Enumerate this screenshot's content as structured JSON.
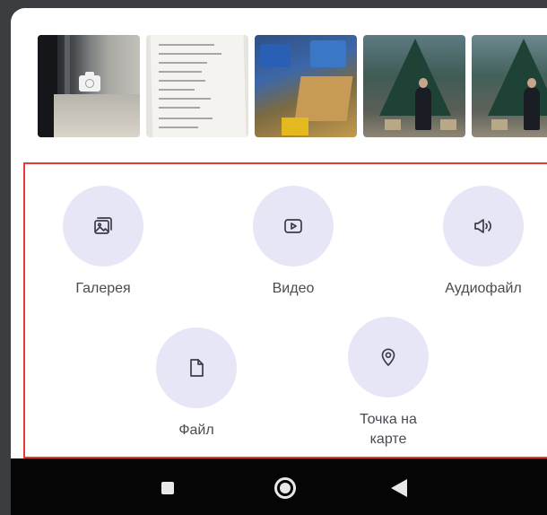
{
  "gallery": {
    "thumbnails": [
      {
        "name": "camera-capture",
        "icon": "camera-icon"
      },
      {
        "name": "photo-document"
      },
      {
        "name": "photo-boxes"
      },
      {
        "name": "photo-christmas-tree-1"
      },
      {
        "name": "photo-christmas-tree-2"
      }
    ]
  },
  "attach_options": [
    {
      "label": "Галерея",
      "icon": "gallery-icon"
    },
    {
      "label": "Видео",
      "icon": "video-icon"
    },
    {
      "label": "Аудиофайл",
      "icon": "speaker-icon"
    },
    {
      "label": "Файл",
      "icon": "file-icon"
    },
    {
      "label": "Точка на\nкарте",
      "icon": "location-pin-icon"
    }
  ],
  "colors": {
    "background": "#3b3d41",
    "circle": "#e7e6f7",
    "highlight_border": "#e53935",
    "navbar": "#050505"
  },
  "navbar": {
    "buttons": [
      "recents-icon",
      "home-icon",
      "back-icon"
    ]
  }
}
